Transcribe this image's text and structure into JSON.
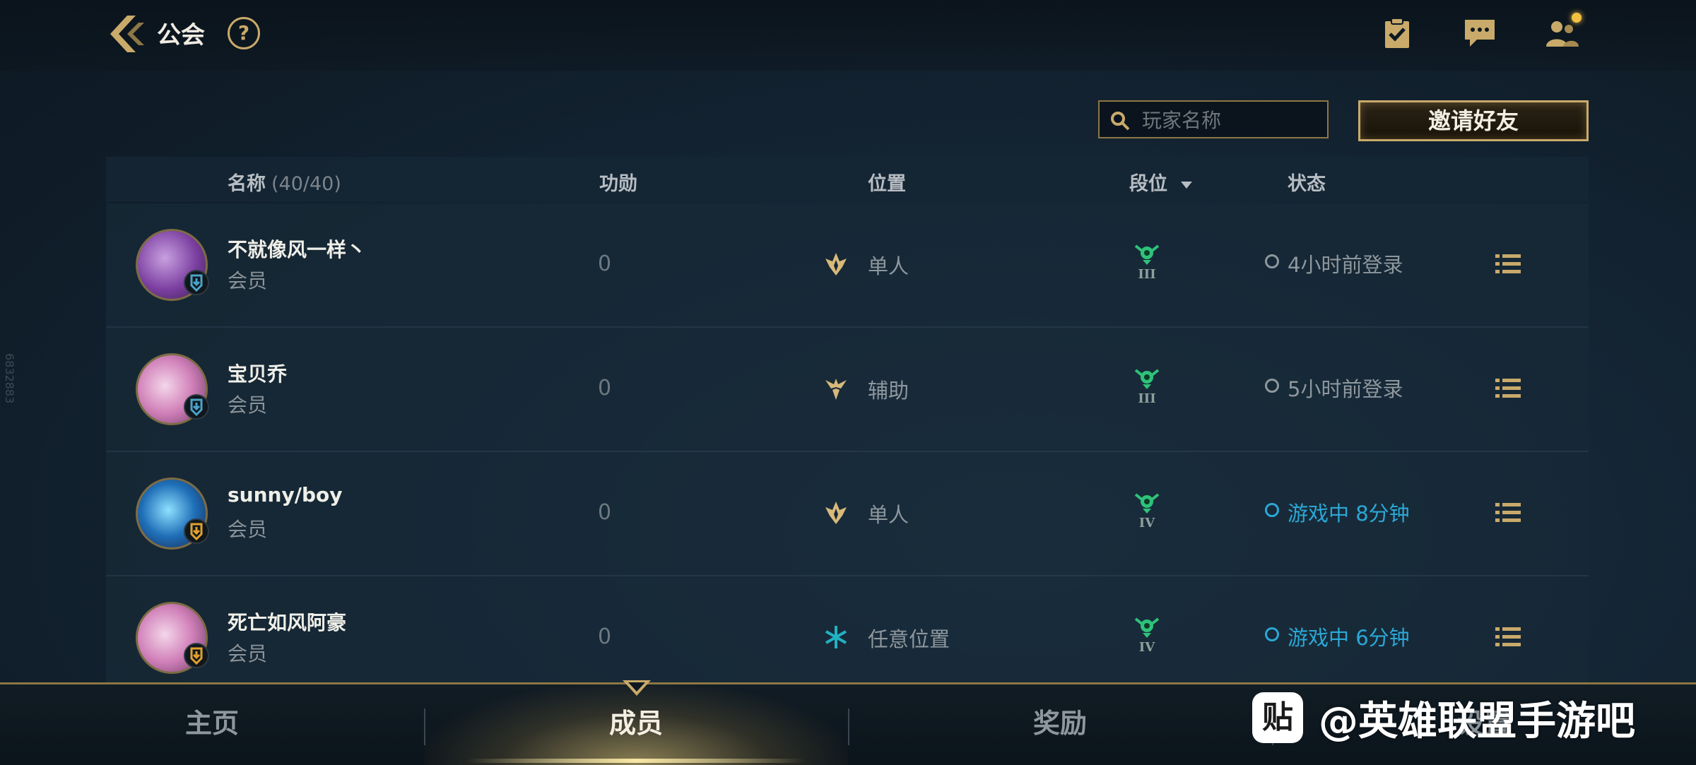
{
  "header": {
    "title": "公会",
    "help_label": "?"
  },
  "search": {
    "placeholder": "玩家名称"
  },
  "invite_label": "邀请好友",
  "columns": {
    "name": "名称",
    "count": "(40/40)",
    "merit": "功勋",
    "position": "位置",
    "rank": "段位",
    "status": "状态"
  },
  "members": [
    {
      "name": "不就像风一样丶",
      "role": "会员",
      "merit": "0",
      "position": "单人",
      "position_icon": "solo-lane-icon",
      "rank_tier": "III",
      "status": "4小时前登录",
      "online": false,
      "badge_color": "#4aa3c8"
    },
    {
      "name": "宝贝乔",
      "role": "会员",
      "merit": "0",
      "position": "辅助",
      "position_icon": "support-icon",
      "rank_tier": "III",
      "status": "5小时前登录",
      "online": false,
      "badge_color": "#4aa3c8"
    },
    {
      "name": "sunny/boy",
      "role": "会员",
      "merit": "0",
      "position": "单人",
      "position_icon": "solo-lane-icon",
      "rank_tier": "IV",
      "status": "游戏中 8分钟",
      "online": true,
      "badge_color": "#e0a030"
    },
    {
      "name": "死亡如风阿豪",
      "role": "会员",
      "merit": "0",
      "position": "任意位置",
      "position_icon": "fill-position-icon",
      "rank_tier": "IV",
      "status": "游戏中 6分钟",
      "online": true,
      "badge_color": "#e0a030"
    }
  ],
  "nav": {
    "tabs": [
      "主页",
      "成员",
      "奖励",
      "设置"
    ],
    "active": "成员"
  },
  "watermark": {
    "logo_text": "贴",
    "text": "@英雄联盟手游吧"
  },
  "side_id": "6832883",
  "colors": {
    "gold": "#c9aa6a",
    "online": "#2ba8d6",
    "offline": "#8e979d",
    "rank_green": "#2ec27a"
  }
}
